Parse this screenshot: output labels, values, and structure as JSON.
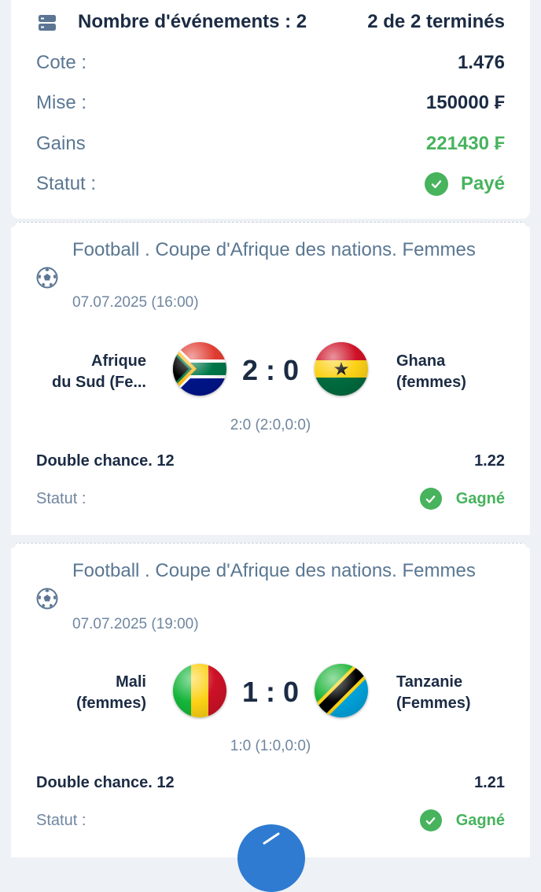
{
  "summary": {
    "events_label": "Nombre d'événements : 2",
    "finished_label": "2 de 2 terminés",
    "odds_label": "Cote :",
    "odds_value": "1.476",
    "stake_label": "Mise :",
    "stake_value": "150000 ₣",
    "winnings_label": "Gains",
    "winnings_value": "221430 ₣",
    "status_label": "Statut :",
    "status_value": "Payé"
  },
  "events": [
    {
      "title": "Football . Coupe d'Afrique des nations. Femmes",
      "date": "07.07.2025 (16:00)",
      "home": [
        "Afrique",
        "du Sud (Fe..."
      ],
      "away": [
        "Ghana",
        "(femmes)"
      ],
      "score": "2 : 0",
      "score_detail": "2:0 (2:0,0:0)",
      "bet": "Double chance. 12",
      "bet_odds": "1.22",
      "status_label": "Statut :",
      "status_value": "Gagné",
      "home_flag": "south-africa-flag-icon",
      "away_flag": "ghana-flag-icon"
    },
    {
      "title": "Football . Coupe d'Afrique des nations. Femmes",
      "date": "07.07.2025 (19:00)",
      "home": [
        "Mali",
        "(femmes)"
      ],
      "away": [
        "Tanzanie",
        "(Femmes)"
      ],
      "score": "1 : 0",
      "score_detail": "1:0 (1:0,0:0)",
      "bet": "Double chance. 12",
      "bet_odds": "1.21",
      "status_label": "Statut :",
      "status_value": "Gagné",
      "home_flag": "mali-flag-icon",
      "away_flag": "tanzania-flag-icon"
    }
  ],
  "colors": {
    "accent_green": "#47b35d",
    "text_dark": "#1b2b44",
    "text_muted": "#5a7792",
    "fab_blue": "#2e7bd1"
  }
}
